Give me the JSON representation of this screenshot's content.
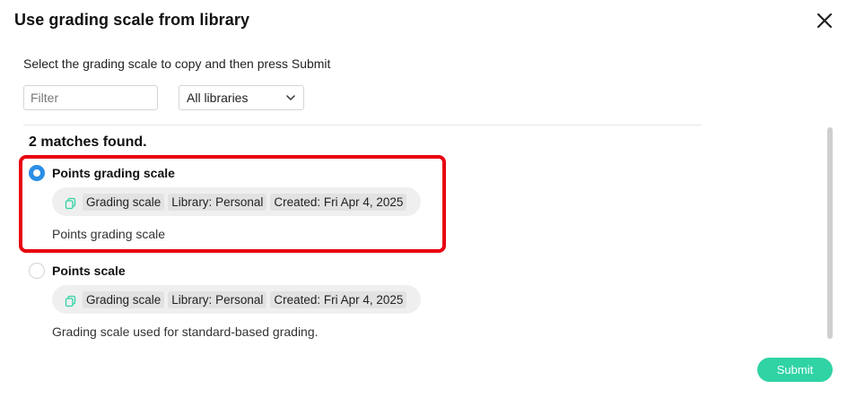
{
  "dialog": {
    "title": "Use grading scale from library",
    "instructions": "Select the grading scale to copy and then press Submit",
    "submit_label": "Submit"
  },
  "filter": {
    "placeholder": "Filter",
    "value": ""
  },
  "library_select": {
    "selected": "All libraries"
  },
  "results": {
    "count_text": "2 matches found.",
    "items": [
      {
        "title": "Points grading scale",
        "selected": true,
        "type": "Grading scale",
        "library": "Library: Personal",
        "created": "Created: Fri Apr 4, 2025",
        "description": "Points grading scale"
      },
      {
        "title": "Points scale",
        "selected": false,
        "type": "Grading scale",
        "library": "Library: Personal",
        "created": "Created: Fri Apr 4, 2025",
        "description": "Grading scale used for standard-based grading."
      }
    ]
  },
  "colors": {
    "accent_radio": "#2b8ee6",
    "submit_button": "#2fd3a4",
    "highlight_border": "#e8000f",
    "copy_icon": "#2fd3a4"
  },
  "icons": {
    "close": "close-icon",
    "dropdown": "chevron-down-icon",
    "copy": "copy-icon"
  }
}
